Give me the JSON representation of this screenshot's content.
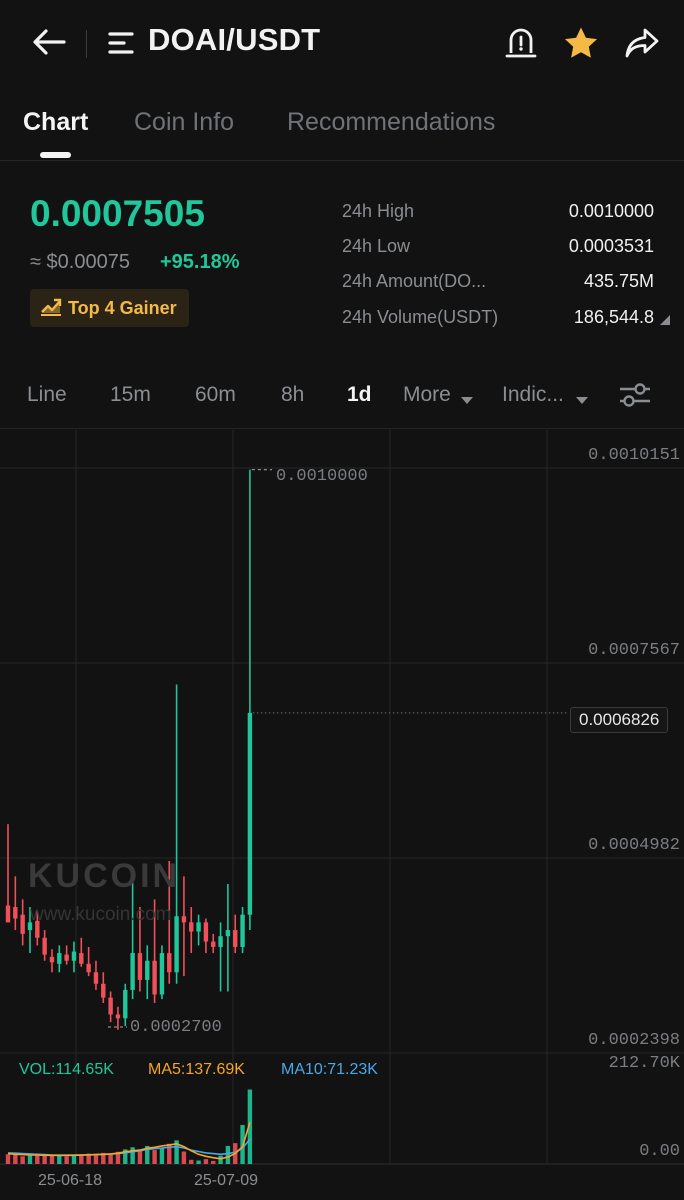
{
  "header": {
    "title": "DOAI/USDT"
  },
  "tabs": [
    {
      "label": "Chart",
      "active": true
    },
    {
      "label": "Coin Info",
      "active": false
    },
    {
      "label": "Recommendations",
      "active": false
    }
  ],
  "price": {
    "last": "0.0007505",
    "approx_usd": "≈ $0.00075",
    "change": "+95.18%",
    "badge": "Top 4 Gainer"
  },
  "stats": [
    {
      "label": "24h High",
      "value": "0.0010000"
    },
    {
      "label": "24h Low",
      "value": "0.0003531"
    },
    {
      "label": "24h Amount(DO...",
      "value": "435.75M"
    },
    {
      "label": "24h Volume(USDT)",
      "value": "186,544.8"
    }
  ],
  "intervals": [
    {
      "label": "Line",
      "active": false
    },
    {
      "label": "15m",
      "active": false
    },
    {
      "label": "60m",
      "active": false
    },
    {
      "label": "8h",
      "active": false
    },
    {
      "label": "1d",
      "active": true
    },
    {
      "label": "More",
      "active": false
    },
    {
      "label": "Indic...",
      "active": false
    }
  ],
  "colors": {
    "up": "#1fc79a",
    "down": "#f0505a",
    "accent_gold": "#f5b947",
    "ma5": "#f5a623",
    "ma10": "#4aa8e8",
    "background": "#121212"
  },
  "watermark": {
    "brand": "KUCOIN",
    "url": "www.kucoin.com"
  },
  "chart_data": {
    "type": "candlestick",
    "y_axis_labels": [
      "0.0010151",
      "0.0007567",
      "0.0004982",
      "0.0002398"
    ],
    "current_price_tag": "0.0006826",
    "max_annotation": "0.0010000",
    "min_annotation": "0.0002700",
    "x_labels": [
      "25-06-18",
      "25-07-09"
    ],
    "ylim": [
      0.0002398,
      0.0010151
    ],
    "candles": [
      {
        "o": 0.000432,
        "h": 0.000538,
        "l": 0.00041,
        "c": 0.00041
      },
      {
        "o": 0.00043,
        "h": 0.00047,
        "l": 0.0004,
        "c": 0.000415
      },
      {
        "o": 0.00042,
        "h": 0.00044,
        "l": 0.00038,
        "c": 0.000395
      },
      {
        "o": 0.0004,
        "h": 0.00043,
        "l": 0.00037,
        "c": 0.00041
      },
      {
        "o": 0.000412,
        "h": 0.000425,
        "l": 0.00038,
        "c": 0.00039
      },
      {
        "o": 0.00039,
        "h": 0.0004,
        "l": 0.00036,
        "c": 0.000368
      },
      {
        "o": 0.000365,
        "h": 0.000375,
        "l": 0.000345,
        "c": 0.000358
      },
      {
        "o": 0.000356,
        "h": 0.00038,
        "l": 0.000345,
        "c": 0.00037
      },
      {
        "o": 0.000368,
        "h": 0.00038,
        "l": 0.000355,
        "c": 0.00036
      },
      {
        "o": 0.00036,
        "h": 0.000385,
        "l": 0.000345,
        "c": 0.000372
      },
      {
        "o": 0.00037,
        "h": 0.00039,
        "l": 0.000352,
        "c": 0.000356
      },
      {
        "o": 0.000356,
        "h": 0.000378,
        "l": 0.00034,
        "c": 0.000345
      },
      {
        "o": 0.000345,
        "h": 0.00036,
        "l": 0.000322,
        "c": 0.00033
      },
      {
        "o": 0.00033,
        "h": 0.000345,
        "l": 0.000305,
        "c": 0.000312
      },
      {
        "o": 0.000312,
        "h": 0.00032,
        "l": 0.00028,
        "c": 0.00029
      },
      {
        "o": 0.00029,
        "h": 0.0003,
        "l": 0.00027,
        "c": 0.000285
      },
      {
        "o": 0.000285,
        "h": 0.00033,
        "l": 0.000275,
        "c": 0.000322
      },
      {
        "o": 0.000322,
        "h": 0.00047,
        "l": 0.00031,
        "c": 0.00037
      },
      {
        "o": 0.00037,
        "h": 0.00043,
        "l": 0.00032,
        "c": 0.000335
      },
      {
        "o": 0.000335,
        "h": 0.00038,
        "l": 0.00031,
        "c": 0.00036
      },
      {
        "o": 0.00036,
        "h": 0.00044,
        "l": 0.000305,
        "c": 0.000316
      },
      {
        "o": 0.000316,
        "h": 0.00038,
        "l": 0.00031,
        "c": 0.00037
      },
      {
        "o": 0.00037,
        "h": 0.00049,
        "l": 0.00033,
        "c": 0.000345
      },
      {
        "o": 0.000345,
        "h": 0.00072,
        "l": 0.00033,
        "c": 0.000418
      },
      {
        "o": 0.000418,
        "h": 0.00047,
        "l": 0.00034,
        "c": 0.00041
      },
      {
        "o": 0.00041,
        "h": 0.00043,
        "l": 0.00037,
        "c": 0.000398
      },
      {
        "o": 0.000398,
        "h": 0.00042,
        "l": 0.00038,
        "c": 0.00041
      },
      {
        "o": 0.00041,
        "h": 0.000415,
        "l": 0.00037,
        "c": 0.000385
      },
      {
        "o": 0.000385,
        "h": 0.000395,
        "l": 0.00037,
        "c": 0.000378
      },
      {
        "o": 0.000378,
        "h": 0.00041,
        "l": 0.00032,
        "c": 0.000392
      },
      {
        "o": 0.000392,
        "h": 0.00046,
        "l": 0.00032,
        "c": 0.0004
      },
      {
        "o": 0.0004,
        "h": 0.00042,
        "l": 0.00037,
        "c": 0.000378
      },
      {
        "o": 0.000378,
        "h": 0.00043,
        "l": 0.00037,
        "c": 0.00042
      },
      {
        "o": 0.00042,
        "h": 0.001,
        "l": 0.0004,
        "c": 0.000683
      }
    ],
    "volume": {
      "legend": {
        "vol": "VOL:114.65K",
        "ma5": "MA5:137.69K",
        "ma10": "MA10:71.23K"
      },
      "ylabels": [
        "212.70K",
        "0.00"
      ],
      "ymax": 212700,
      "values": [
        28000,
        26000,
        22000,
        25000,
        30000,
        27000,
        24000,
        26000,
        22000,
        25000,
        27000,
        30000,
        26000,
        32000,
        29000,
        35000,
        42000,
        48000,
        38000,
        52000,
        40000,
        45000,
        58000,
        68000,
        36000,
        12000,
        10000,
        14000,
        9000,
        24000,
        52000,
        60000,
        112000,
        214000
      ],
      "ma5": [
        30000,
        28000,
        27000,
        26000,
        26000,
        25000,
        25000,
        24500,
        24500,
        25000,
        25500,
        26000,
        27000,
        28000,
        29000,
        31000,
        35000,
        38000,
        40000,
        45000,
        48000,
        52000,
        55000,
        58000,
        50000,
        38000,
        28000,
        22000,
        18000,
        15000,
        20000,
        30000,
        50000,
        120000
      ],
      "ma10": [
        32000,
        31000,
        30000,
        29000,
        28000,
        27000,
        26000,
        26000,
        25500,
        25500,
        26000,
        26500,
        27000,
        27500,
        28500,
        30000,
        32000,
        35000,
        38000,
        42000,
        44000,
        46000,
        48000,
        50000,
        46000,
        40000,
        36000,
        32000,
        30000,
        28000,
        30000,
        34000,
        45000,
        72000
      ]
    }
  }
}
